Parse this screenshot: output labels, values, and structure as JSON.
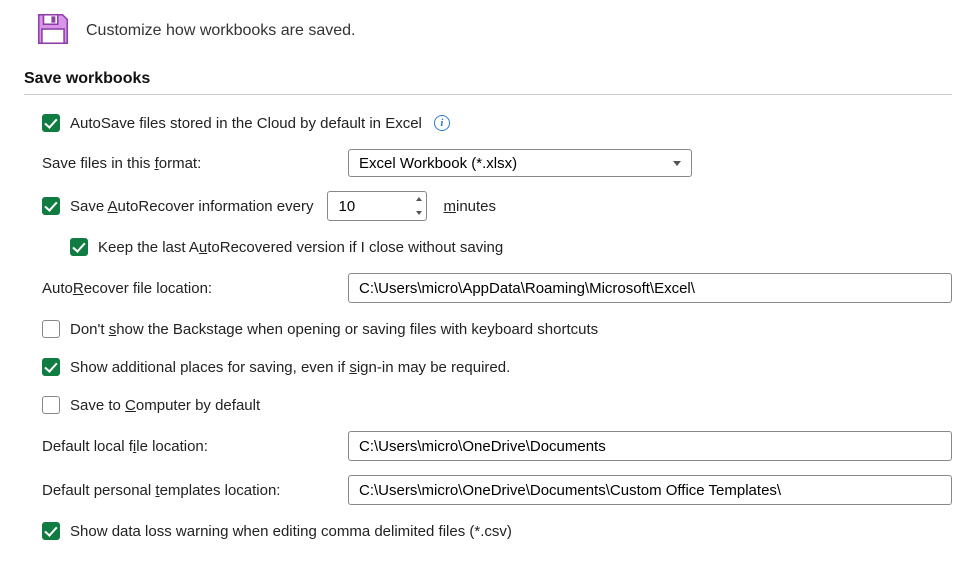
{
  "header": {
    "text": "Customize how workbooks are saved."
  },
  "section": {
    "title": "Save workbooks"
  },
  "autosave": {
    "label_pre": "AutoSave files stored in the Cloud by default in Excel",
    "checked": true
  },
  "save_format": {
    "label": "Save files in this ",
    "label_u": "f",
    "label_post": "ormat:",
    "value": "Excel Workbook (*.xlsx)"
  },
  "autorecover": {
    "label_pre": "Save ",
    "label_u": "A",
    "label_post": "utoRecover information every",
    "interval": "10",
    "minutes_u": "m",
    "minutes_post": "inutes",
    "checked": true
  },
  "keep_last": {
    "label_pre": "Keep the last A",
    "label_u": "u",
    "label_post": "toRecovered version if I close without saving",
    "checked": true
  },
  "autorecover_location": {
    "label_pre": "Auto",
    "label_u": "R",
    "label_post": "ecover file location:",
    "value": "C:\\Users\\micro\\AppData\\Roaming\\Microsoft\\Excel\\"
  },
  "dont_show_backstage": {
    "label_pre": "Don't ",
    "label_u": "s",
    "label_post": "how the Backstage when opening or saving files with keyboard shortcuts",
    "checked": false
  },
  "show_additional": {
    "label_pre": "Show additional places for saving, even if ",
    "label_u": "s",
    "label_post": "ign-in may be required.",
    "checked": true
  },
  "save_to_computer": {
    "label_pre": "Save to ",
    "label_u": "C",
    "label_post": "omputer by default",
    "checked": false
  },
  "default_local": {
    "label_pre": "Default local f",
    "label_u": "i",
    "label_post": "le location:",
    "value": "C:\\Users\\micro\\OneDrive\\Documents"
  },
  "default_templates": {
    "label_pre": "Default personal ",
    "label_u": "t",
    "label_post": "emplates location:",
    "value": "C:\\Users\\micro\\OneDrive\\Documents\\Custom Office Templates\\"
  },
  "data_loss_warning": {
    "label": "Show data loss warning when editing comma delimited files (*.csv)",
    "checked": true
  },
  "info_glyph": "i"
}
